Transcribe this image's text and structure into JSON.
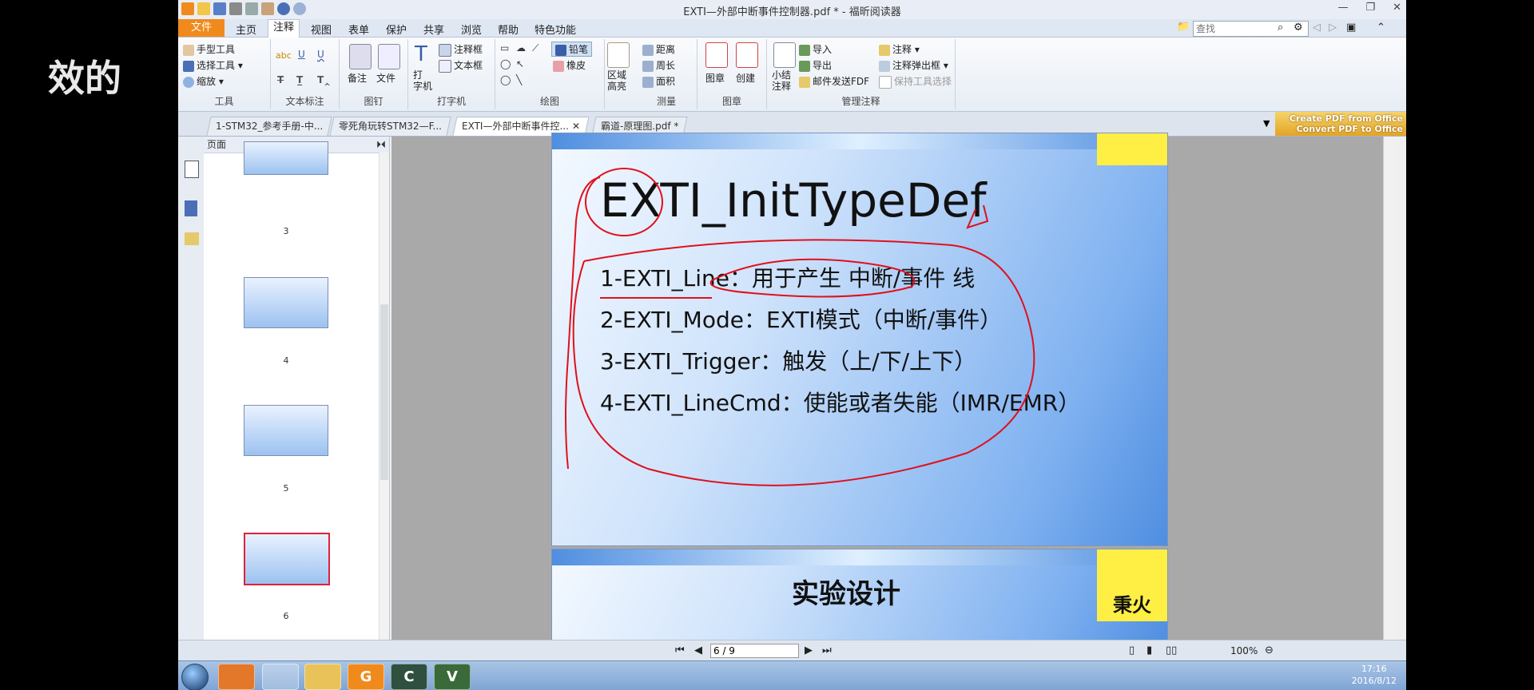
{
  "overlay_text": "效的",
  "window": {
    "title": "EXTI—外部中断事件控制器.pdf * - 福昕阅读器",
    "min": "▭",
    "max": "▭",
    "close": "✕"
  },
  "menu": {
    "file": "文件",
    "items": [
      "主页",
      "注释",
      "视图",
      "表单",
      "保护",
      "共享",
      "浏览",
      "帮助",
      "特色功能"
    ],
    "active": "注释",
    "search_placeholder": "查找"
  },
  "ribbon": {
    "tools": {
      "hand": "手型工具",
      "select": "选择工具",
      "zoom": "缩放",
      "label": "工具"
    },
    "text_markup": {
      "label": "文本标注"
    },
    "pin": {
      "note": "备注",
      "file": "文件",
      "label": "图钉"
    },
    "typewriter": {
      "type": "打\n字机",
      "callout": "注释框",
      "textbox": "文本框",
      "label": "打字机"
    },
    "drawing": {
      "pencil": "铅笔",
      "eraser": "橡皮",
      "area_highlight": "区域\n高亮",
      "label": "绘图"
    },
    "measure": {
      "distance": "距离",
      "perimeter": "周长",
      "area": "面积",
      "label": "测量"
    },
    "stamp": {
      "stamp": "图章",
      "create": "创建",
      "label": "图章"
    },
    "manage": {
      "summary": "小结\n注释",
      "import": "导入",
      "export": "导出",
      "email_fdf": "邮件发送FDF",
      "comment": "注释",
      "popup": "注释弹出框",
      "keep_tool": "保持工具选择",
      "label": "管理注释"
    }
  },
  "tabs": [
    {
      "label": "1-STM32_参考手册-中..."
    },
    {
      "label": "零死角玩转STM32—F..."
    },
    {
      "label": "EXTI—外部中断事件控..."
    },
    {
      "label": "霸道-原理图.pdf *"
    }
  ],
  "promo": {
    "line1": "Create PDF from Office",
    "line2": "Convert PDF to Office"
  },
  "panel": {
    "title": "页面",
    "thumbs": [
      {
        "num": "3"
      },
      {
        "num": "4"
      },
      {
        "num": "5"
      },
      {
        "num": "6"
      }
    ]
  },
  "slide": {
    "title": "EXTI_InitTypeDef",
    "lines": [
      "1-EXTI_Line：用于产生 中断/事件 线",
      "2-EXTI_Mode：EXTI模式（中断/事件）",
      "3-EXTI_Trigger：触发（上/下/上下）",
      "4-EXTI_LineCmd：使能或者失能（IMR/EMR）"
    ],
    "logo": "秉火",
    "next_title": "实验设计"
  },
  "status": {
    "page": "6 / 9",
    "zoom": "100%"
  },
  "taskbar": {
    "time": "17:16",
    "date": "2016/8/12"
  },
  "colors": {
    "accent": "#f08a1c",
    "ink": "#e0101c"
  }
}
